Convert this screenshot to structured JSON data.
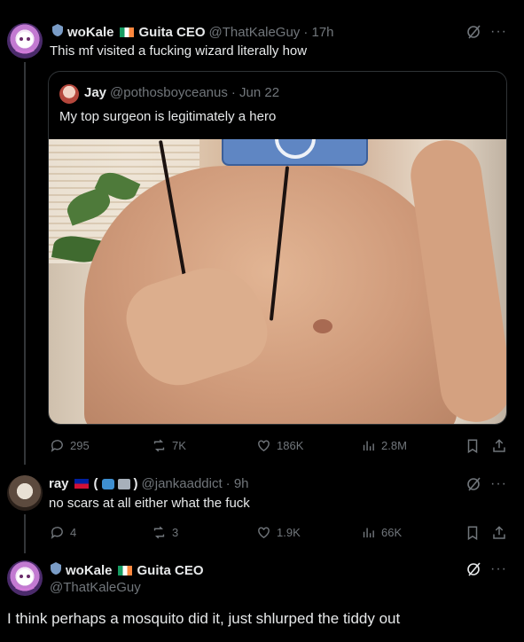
{
  "tweet1": {
    "name": "woKale",
    "name_suffix": "Guita CEO",
    "handle": "@ThatKaleGuy",
    "time": "· 17h",
    "text": "This mf visited a fucking wizard literally how",
    "quote": {
      "name": "Jay",
      "handle": "@pothosboyceanus",
      "time": "· Jun 22",
      "text": "My top surgeon is legitimately a hero"
    },
    "metrics": {
      "replies": "295",
      "reposts": "7K",
      "likes": "186K",
      "views": "2.8M"
    }
  },
  "tweet2": {
    "name": "ray",
    "name_tags": "(",
    "name_tags_end": ")",
    "handle": "@jankaaddict",
    "time": "· 9h",
    "text": "no scars at all either what the fuck",
    "metrics": {
      "replies": "4",
      "reposts": "3",
      "likes": "1.9K",
      "views": "66K"
    }
  },
  "tweet3": {
    "name": "woKale",
    "name_suffix": "Guita CEO",
    "handle": "@ThatKaleGuy",
    "text": "I think perhaps a mosquito did it, just shlurped the tiddy out"
  },
  "colors": {
    "background": "#000000",
    "text": "#e7e9ea",
    "muted": "#71767b",
    "border": "#2f3336",
    "verified": "#1d9bf0"
  },
  "icons": [
    "shield-badge-icon",
    "grok-icon",
    "more-icon",
    "reply-icon",
    "repost-icon",
    "like-icon",
    "views-icon",
    "bookmark-icon",
    "share-icon"
  ]
}
